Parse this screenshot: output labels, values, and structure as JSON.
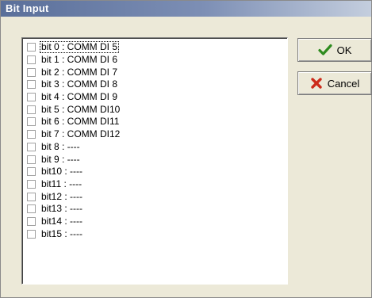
{
  "window": {
    "title": "Bit Input"
  },
  "buttons": {
    "ok_label": "OK",
    "cancel_label": "Cancel"
  },
  "bits": [
    {
      "label": "bit 0 : COMM DI 5",
      "checked": false
    },
    {
      "label": "bit 1 : COMM DI 6",
      "checked": false
    },
    {
      "label": "bit 2 : COMM DI 7",
      "checked": false
    },
    {
      "label": "bit 3 : COMM DI 8",
      "checked": false
    },
    {
      "label": "bit 4 : COMM DI 9",
      "checked": false
    },
    {
      "label": "bit 5 : COMM DI10",
      "checked": false
    },
    {
      "label": "bit 6 : COMM DI11",
      "checked": false
    },
    {
      "label": "bit 7 : COMM DI12",
      "checked": false
    },
    {
      "label": "bit 8 : ----",
      "checked": false
    },
    {
      "label": "bit 9 : ----",
      "checked": false
    },
    {
      "label": "bit10 : ----",
      "checked": false
    },
    {
      "label": "bit11 : ----",
      "checked": false
    },
    {
      "label": "bit12 : ----",
      "checked": false
    },
    {
      "label": "bit13 : ----",
      "checked": false
    },
    {
      "label": "bit14 : ----",
      "checked": false
    },
    {
      "label": "bit15 : ----",
      "checked": false
    }
  ],
  "icons": {
    "ok": "checkmark-icon",
    "cancel": "x-icon"
  },
  "colors": {
    "ok_check": "#2e8b1f",
    "cancel_x": "#cc2a1a",
    "titlebar": "#5a6f9a"
  }
}
